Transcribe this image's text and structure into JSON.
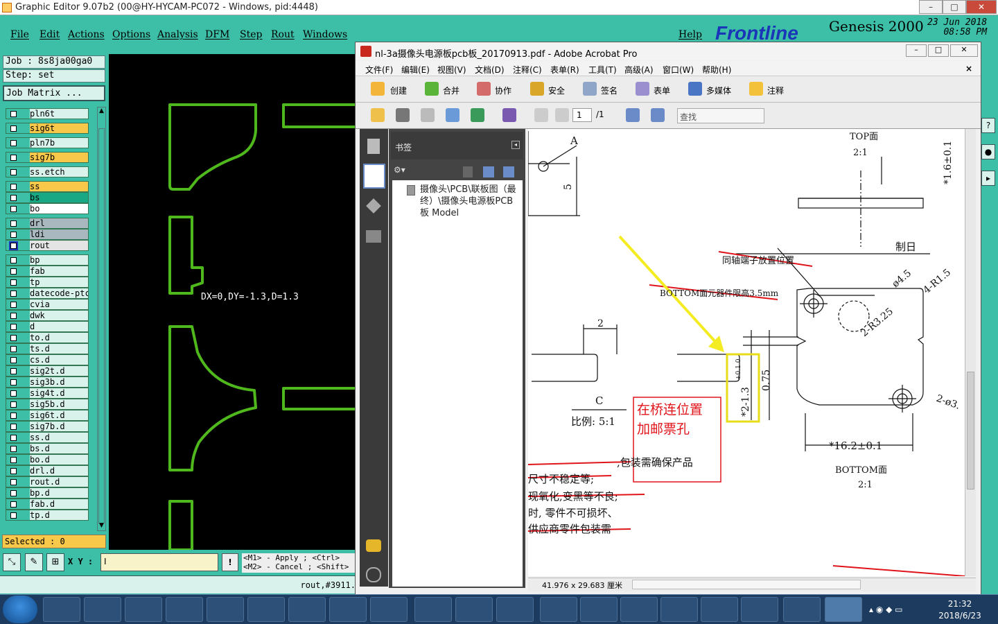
{
  "genesis": {
    "title": "Graphic Editor 9.07b2 (00@HY-HYCAM-PC072 - Windows, pid:4448)",
    "menu": [
      "File",
      "Edit",
      "Actions",
      "Options",
      "Analysis",
      "DFM",
      "Step",
      "Rout",
      "Windows"
    ],
    "help": "Help",
    "brand": {
      "logo": "Frontline",
      "product": "Genesis 2000",
      "date": "23 Jun 2018",
      "time": "08:58 PM"
    },
    "job": "Job : 8s8ja00ga0",
    "step": "Step: set",
    "job_matrix": "Job Matrix ...",
    "layers": [
      {
        "name": "pln6t",
        "color": "#d9f2ec"
      },
      {
        "name": "sig6t",
        "color": "#f7c84a"
      },
      {
        "name": "pln7b",
        "color": "#d9f2ec"
      },
      {
        "name": "sig7b",
        "color": "#f7c84a"
      },
      {
        "name": "ss.etch",
        "color": "#d9f2ec"
      },
      {
        "name": "ss",
        "color": "#f7c84a"
      },
      {
        "name": "bs",
        "color": "#18a884"
      },
      {
        "name": "bo",
        "color": "#ffffff"
      },
      {
        "name": "drl",
        "color": "#a9b8bf"
      },
      {
        "name": "ldi",
        "color": "#a9b8bf"
      },
      {
        "name": "rout",
        "color": "#e4e4e4"
      },
      {
        "name": "bp",
        "color": "#d9f2ec"
      },
      {
        "name": "fab",
        "color": "#d9f2ec"
      },
      {
        "name": "tp",
        "color": "#d9f2ec"
      },
      {
        "name": "datecode-ptc",
        "color": "#d9f2ec"
      },
      {
        "name": "cvia",
        "color": "#d9f2ec"
      },
      {
        "name": "dwk",
        "color": "#d9f2ec"
      },
      {
        "name": "d",
        "color": "#d9f2ec"
      },
      {
        "name": "to.d",
        "color": "#d9f2ec"
      },
      {
        "name": "ts.d",
        "color": "#d9f2ec"
      },
      {
        "name": "cs.d",
        "color": "#d9f2ec"
      },
      {
        "name": "sig2t.d",
        "color": "#d9f2ec"
      },
      {
        "name": "sig3b.d",
        "color": "#d9f2ec"
      },
      {
        "name": "sig4t.d",
        "color": "#d9f2ec"
      },
      {
        "name": "sig5b.d",
        "color": "#d9f2ec"
      },
      {
        "name": "sig6t.d",
        "color": "#d9f2ec"
      },
      {
        "name": "sig7b.d",
        "color": "#d9f2ec"
      },
      {
        "name": "ss.d",
        "color": "#d9f2ec"
      },
      {
        "name": "bs.d",
        "color": "#d9f2ec"
      },
      {
        "name": "bo.d",
        "color": "#d9f2ec"
      },
      {
        "name": "drl.d",
        "color": "#d9f2ec"
      },
      {
        "name": "rout.d",
        "color": "#d9f2ec"
      },
      {
        "name": "bp.d",
        "color": "#d9f2ec"
      },
      {
        "name": "fab.d",
        "color": "#d9f2ec"
      },
      {
        "name": "tp.d",
        "color": "#d9f2ec"
      }
    ],
    "selected": "Selected : 0",
    "measure": "DX=0,DY=-1.3,D=1.3",
    "xy_label": "X Y :",
    "xy_value": "I",
    "mouse_help": [
      "<M1> - Apply  ; <Ctrl>",
      "<M2> - Cancel ; <Shift>"
    ],
    "status": "rout,#3911."
  },
  "acrobat": {
    "title": "nl-3a摄像头电源板pcb板_20170913.pdf - Adobe Acrobat Pro",
    "menu": [
      "文件(F)",
      "编辑(E)",
      "视图(V)",
      "文档(D)",
      "注释(C)",
      "表单(R)",
      "工具(T)",
      "高级(A)",
      "窗口(W)",
      "帮助(H)"
    ],
    "toolbar": [
      "创建",
      "合并",
      "协作",
      "安全",
      "签名",
      "表单",
      "多媒体",
      "注释"
    ],
    "page_current": "1",
    "page_total": "/1",
    "find_placeholder": "查找",
    "bookmarks_title": "书签",
    "bookmark_item": "摄像头\\PCB\\联板图（最终）\\摄像头电源板PCB板 Model",
    "page_size": "41.976 x 29.683 厘米",
    "drawing": {
      "top_label": "TOP面",
      "top_scale": "2:1",
      "bottom_label": "BOTTOM面",
      "bottom_scale": "2:1",
      "note_coax": "同轴端子放置位置",
      "note_bottom": "BOTTOM面元器件限高3.5mm",
      "label_zhiri": "制日",
      "dim_phi": "ø4.5",
      "dim_r325": "2-R3.25",
      "dim_r15": "4-R1.5",
      "dim_phi3": "2-ø3.",
      "dim_2": "2",
      "dim_5": "5",
      "label_A": "A",
      "label_C": "C",
      "scale_c": "比例: 5:1",
      "dim_075": "0.75",
      "dim_13": "*2-1.3",
      "tol_13": "+0.1 0",
      "dim_162": "*16.2±0.1",
      "dim_16": "*1.6±0.1",
      "callout": [
        "在桥连位置",
        "加邮票孔"
      ],
      "notes": [
        ",包装需确保产品",
        "尺寸不稳定等;",
        "现氧化,变黑等不良;",
        "时, 零件不可损坏、",
        "供应商零件包装需"
      ]
    }
  },
  "taskbar": {
    "time": "21:32",
    "date": "2018/6/23"
  }
}
